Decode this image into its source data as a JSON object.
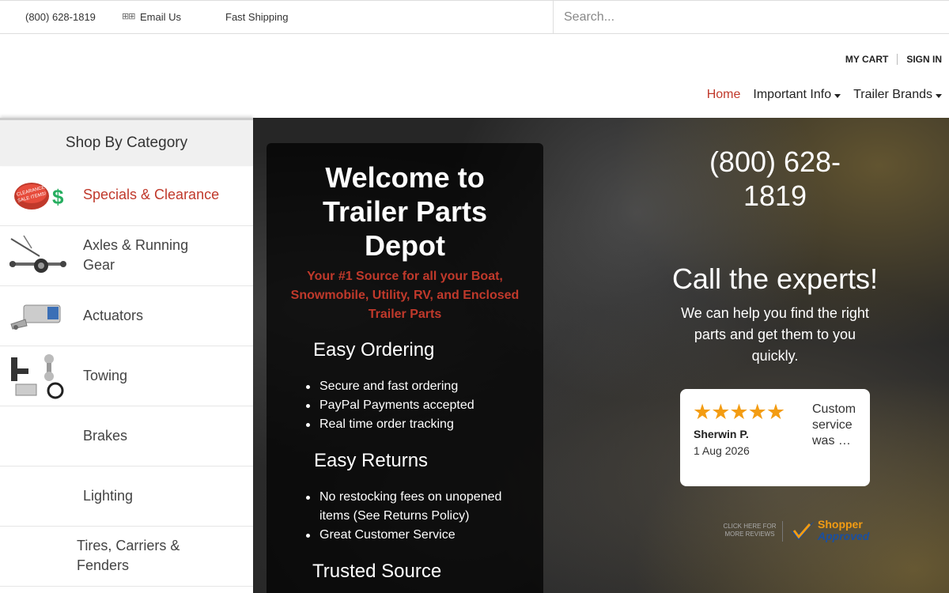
{
  "topbar": {
    "phone": "(800) 628-1819",
    "email_icon": "envelope-icon",
    "email": "Email Us",
    "shipping": "Fast Shipping",
    "search_placeholder": "Search..."
  },
  "header": {
    "cart": "MY CART",
    "sign_in": "SIGN IN",
    "nav": [
      {
        "label": "Home",
        "active": true
      },
      {
        "label": "Important Info",
        "dropdown": true
      },
      {
        "label": "Trailer Brands",
        "dropdown": true
      }
    ]
  },
  "sidebar": {
    "title": "Shop By Category",
    "items": [
      {
        "label": "Specials & Clearance",
        "thumb": "clearance-sale-icon"
      },
      {
        "label": "Axles & Running Gear",
        "thumb": "trailer-axle-icon"
      },
      {
        "label": "Actuators",
        "thumb": "actuator-icon"
      },
      {
        "label": "Towing",
        "thumb": "hitch-ball-icon"
      },
      {
        "label": "Brakes",
        "thumb": ""
      },
      {
        "label": "Lighting",
        "thumb": ""
      },
      {
        "label": "Tires, Carriers & Fenders",
        "thumb": ""
      }
    ]
  },
  "hero": {
    "welcome_title": "Welcome to Trailer Parts Depot",
    "welcome_sub": "Your #1 Source for all your Boat, Snowmobile, Utility, RV, and Enclosed Trailer Parts",
    "sections": [
      {
        "heading": "Easy Ordering",
        "items": [
          "Secure and fast ordering",
          "PayPal Payments accepted",
          "Real time order tracking"
        ]
      },
      {
        "heading": "Easy Returns",
        "items": [
          "No restocking fees on unopened items (See Returns Policy)",
          "Great Customer Service"
        ]
      },
      {
        "heading": "Trusted Source",
        "items": []
      }
    ],
    "phone": "(800) 628-1819",
    "experts_title": "Call the experts!",
    "experts_body": "We can help you find the right parts and get them to you quickly.",
    "review": {
      "stars": "★★★★★",
      "rating": 5,
      "name": "Sherwin P.",
      "date": "1 Aug 2026",
      "text": "Custom service was …"
    },
    "badge": {
      "small": "CLICK HERE FOR MORE REVIEWS",
      "name_line1": "Shopper",
      "name_line2": "Approved"
    }
  },
  "colors": {
    "accent_red": "#c0392b",
    "star_orange": "#f39c12",
    "badge_blue": "#1a4fa0"
  }
}
